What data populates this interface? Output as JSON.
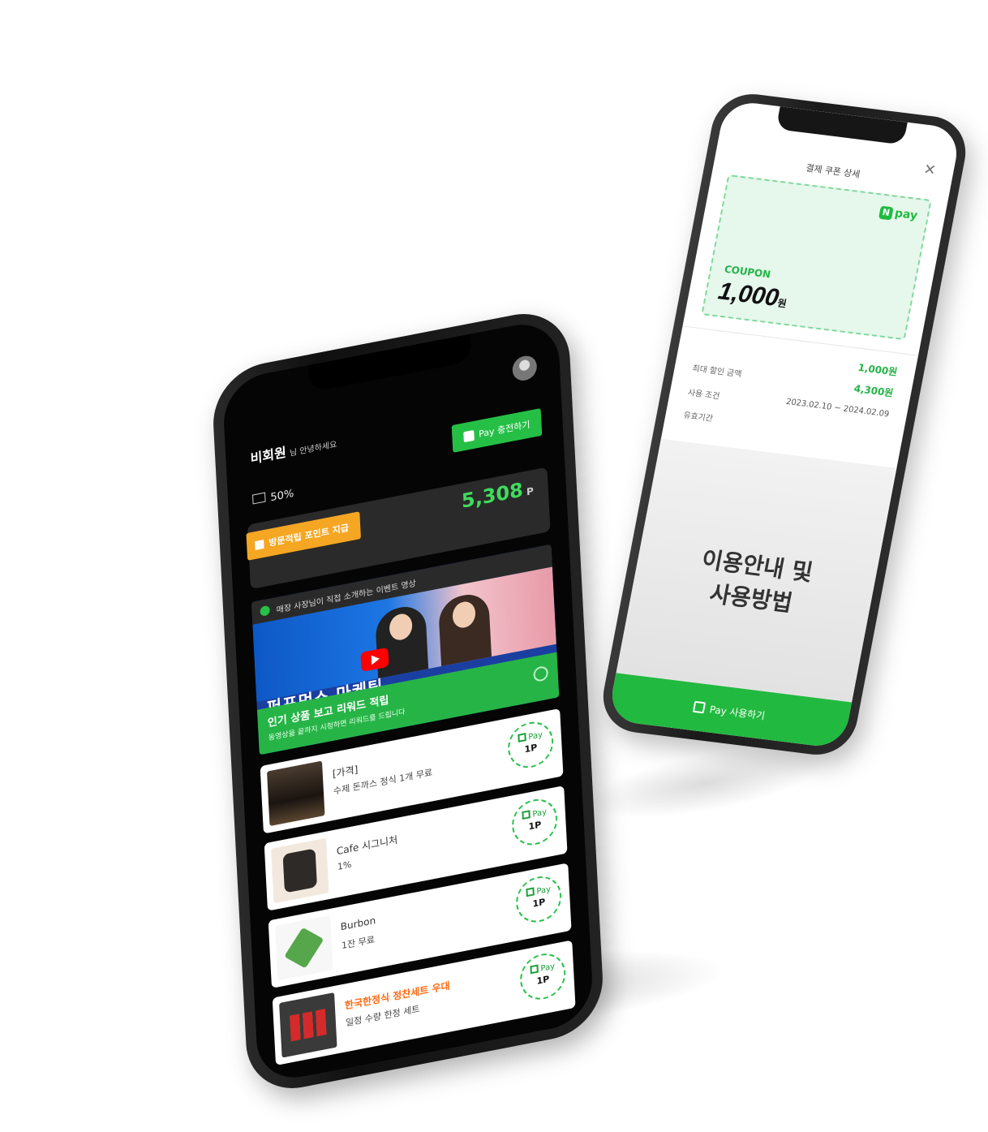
{
  "back_screen": {
    "header_title": "결제 쿠폰 상세",
    "close_label": "✕",
    "coupon": {
      "brand_mark": "N",
      "brand_text": "pay",
      "label": "COUPON",
      "amount": "1,000",
      "unit": "원"
    },
    "details": [
      {
        "label": "",
        "value": "1,000원"
      },
      {
        "label": "최대 할인 금액",
        "value": "4,300원"
      },
      {
        "label": "사용 조건",
        "value": "2023.02.10 ~ 2024.02.09"
      },
      {
        "label": "유효기간",
        "value": ""
      }
    ],
    "guide_text_line1": "이용안내 및",
    "guide_text_line2": "사용방법",
    "footer_label": "Pay 사용하기"
  },
  "front_screen": {
    "user": {
      "name": "비회원",
      "subtitle": "님 안녕하세요"
    },
    "pay_button_label": "Pay 충전하기",
    "level_label": "50%",
    "points": {
      "badge_label": "방문적립 포인트 지급",
      "value": "5,308",
      "unit": "P"
    },
    "video": {
      "top_text": "매장 사장님이 직접 소개하는 이벤트 영상",
      "big_text": "퍼포먼스 마케팅",
      "banner_title": "인기 상품 보고 리워드 적립",
      "banner_subtitle": "동영상을 끝까지 시청하면 리워드를 드립니다"
    },
    "products": [
      {
        "name": "[가격]",
        "desc": "수제 돈까스 정식 1개 무료",
        "stamp_text": "1P",
        "stamp_brand": "Pay"
      },
      {
        "name": "Cafe 시그니처",
        "desc": "1%",
        "stamp_text": "1P",
        "stamp_brand": "Pay"
      },
      {
        "name": "Burbon",
        "desc": "1잔 무료",
        "stamp_text": "1P",
        "stamp_brand": "Pay"
      },
      {
        "name": "한국한정식 정찬세트 우대",
        "desc": "일정 수량 한정 세트",
        "stamp_text": "1P",
        "stamp_brand": "Pay"
      }
    ]
  },
  "colors": {
    "brand_green": "#26bf46",
    "points_orange": "#f5a623",
    "points_value_green": "#3fdc5c",
    "coupon_bg": "#e6f7ec"
  },
  "icons": {
    "avatar": "user-avatar-icon",
    "pay": "pay-square-icon",
    "play": "play-icon",
    "close": "close-icon"
  }
}
